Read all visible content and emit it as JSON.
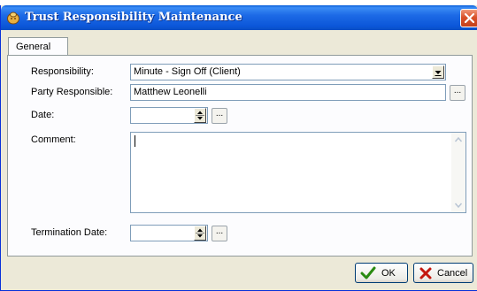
{
  "window": {
    "title": "Trust Responsibility Maintenance"
  },
  "tabs": [
    {
      "label": "General"
    }
  ],
  "form": {
    "responsibility": {
      "label": "Responsibility:",
      "value": "Minute - Sign Off (Client)"
    },
    "party": {
      "label": "Party Responsible:",
      "value": "Matthew Leonelli",
      "button": "..."
    },
    "date": {
      "label": "Date:",
      "value": "",
      "button": "..."
    },
    "comment": {
      "label": "Comment:",
      "value": ""
    },
    "termination_date": {
      "label": "Termination Date:",
      "value": "",
      "button": "..."
    }
  },
  "buttons": {
    "ok": "OK",
    "cancel": "Cancel"
  },
  "colors": {
    "title_bar": "#0a5fd8",
    "close_button": "#d9512a",
    "window_bg": "#ece9d8",
    "ok_check": "#2a8a12",
    "cancel_x": "#c4170f"
  }
}
